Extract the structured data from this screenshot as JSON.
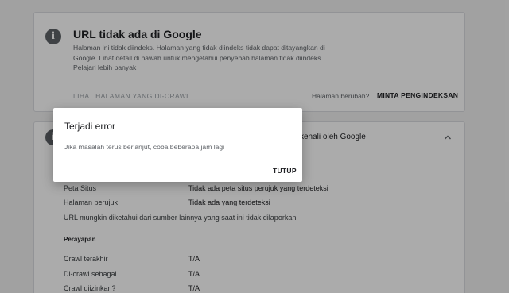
{
  "top_card": {
    "icon": "info-icon",
    "title": "URL tidak ada di Google",
    "description": "Halaman ini tidak diindeks. Halaman yang tidak diindeks tidak dapat ditayangkan di Google. Lihat detail di bawah untuk mengetahui penyebab halaman tidak diindeks.",
    "learn_more": "Pelajari lebih banyak",
    "view_crawled": "LIHAT HALAMAN YANG DI-CRAWL",
    "page_changed": "Halaman berubah?",
    "request_indexing": "MINTA PENGINDEKSAN"
  },
  "coverage_card": {
    "icon": "info-icon",
    "header_suffix": "kenali oleh Google",
    "rows": [
      {
        "label": "Peta Situs",
        "value": "Tidak ada peta situs perujuk yang terdeteksi"
      },
      {
        "label": "Halaman perujuk",
        "value": "Tidak ada yang terdeteksi"
      }
    ],
    "note": "URL mungkin diketahui dari sumber lainnya yang saat ini tidak dilaporkan",
    "crawl_section": "Perayapan",
    "crawl_rows": [
      {
        "label": "Crawl terakhir",
        "value": "T/A"
      },
      {
        "label": "Di-crawl sebagai",
        "value": "T/A"
      },
      {
        "label": "Crawl diizinkan?",
        "value": "T/A"
      }
    ]
  },
  "dialog": {
    "title": "Terjadi error",
    "message": "Jika masalah terus berlanjut, coba beberapa jam lagi",
    "close": "TUTUP"
  }
}
